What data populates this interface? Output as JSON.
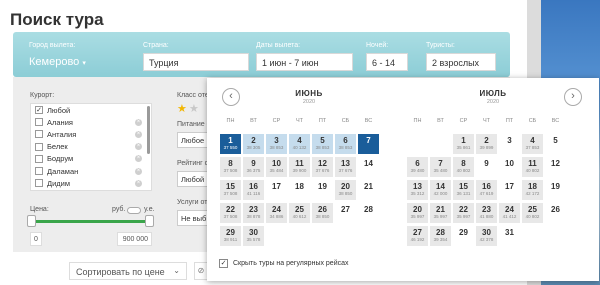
{
  "page": {
    "title": "Поиск тура"
  },
  "search": {
    "departure_label": "Город вылета:",
    "departure_value": "Кемерово",
    "country_label": "Страна:",
    "country_value": "Турция",
    "dates_label": "Даты вылета:",
    "dates_value": "1 июн - 7 июн",
    "nights_label": "Ночей:",
    "nights_value": "6 - 14",
    "tourists_label": "Туристы:",
    "tourists_value": "2 взрослых"
  },
  "filters": {
    "resort_label": "Курорт:",
    "resorts": [
      {
        "label": "Любой",
        "checked": true,
        "removable": false
      },
      {
        "label": "Алания",
        "checked": false,
        "removable": true
      },
      {
        "label": "Анталия",
        "checked": false,
        "removable": true
      },
      {
        "label": "Белек",
        "checked": false,
        "removable": true
      },
      {
        "label": "Бодрум",
        "checked": false,
        "removable": true
      },
      {
        "label": "Даламан",
        "checked": false,
        "removable": true
      },
      {
        "label": "Дидим",
        "checked": false,
        "removable": true
      }
    ],
    "hotel_class_label": "Класс оте",
    "meals_label": "Питание о",
    "meals_value": "Любое",
    "rating_label": "Рейтинг о",
    "rating_value": "Любой",
    "services_label": "Услуги от",
    "services_value": "Не выб",
    "price_label": "Цена:",
    "currency_rub": "руб.",
    "currency_ue": "у.е.",
    "price_min": "0",
    "price_max": "900 000"
  },
  "sort": {
    "label": "Сортировать по цене"
  },
  "calendar": {
    "weekdays": [
      "ПН",
      "ВТ",
      "СР",
      "ЧТ",
      "ПТ",
      "СБ",
      "ВС"
    ],
    "june": {
      "name": "ИЮНЬ",
      "year": "2020",
      "offset": 0,
      "days": [
        {
          "d": "1",
          "p": "37 550",
          "s": "sel"
        },
        {
          "d": "2",
          "p": "38 305",
          "s": "light"
        },
        {
          "d": "3",
          "p": "38 853",
          "s": "light"
        },
        {
          "d": "4",
          "p": "40 132",
          "s": "light"
        },
        {
          "d": "5",
          "p": "38 853",
          "s": "light"
        },
        {
          "d": "6",
          "p": "38 853",
          "s": "light"
        },
        {
          "d": "7",
          "p": "",
          "s": "sel"
        },
        {
          "d": "8",
          "p": "37 508",
          "s": "gray"
        },
        {
          "d": "9",
          "p": "36 375",
          "s": "gray"
        },
        {
          "d": "10",
          "p": "35 484",
          "s": "gray"
        },
        {
          "d": "11",
          "p": "39 900",
          "s": "gray"
        },
        {
          "d": "12",
          "p": "37 676",
          "s": "gray"
        },
        {
          "d": "13",
          "p": "37 676",
          "s": "gray"
        },
        {
          "d": "14",
          "p": "",
          "s": "none"
        },
        {
          "d": "15",
          "p": "37 508",
          "s": "gray"
        },
        {
          "d": "16",
          "p": "41 116",
          "s": "gray"
        },
        {
          "d": "17",
          "p": "",
          "s": "none"
        },
        {
          "d": "18",
          "p": "",
          "s": "none"
        },
        {
          "d": "19",
          "p": "",
          "s": "none"
        },
        {
          "d": "20",
          "p": "38 850",
          "s": "gray"
        },
        {
          "d": "21",
          "p": "",
          "s": "none"
        },
        {
          "d": "22",
          "p": "37 508",
          "s": "gray"
        },
        {
          "d": "23",
          "p": "38 878",
          "s": "gray"
        },
        {
          "d": "24",
          "p": "34 886",
          "s": "gray"
        },
        {
          "d": "25",
          "p": "40 612",
          "s": "gray"
        },
        {
          "d": "26",
          "p": "38 850",
          "s": "gray"
        },
        {
          "d": "27",
          "p": "",
          "s": "none"
        },
        {
          "d": "28",
          "p": "",
          "s": "none"
        },
        {
          "d": "29",
          "p": "38 911",
          "s": "gray"
        },
        {
          "d": "30",
          "p": "35 578",
          "s": "gray"
        }
      ]
    },
    "july": {
      "name": "ИЮЛЬ",
      "year": "2020",
      "offset": 2,
      "days": [
        {
          "d": "1",
          "p": "35 861",
          "s": "gray"
        },
        {
          "d": "2",
          "p": "39 899",
          "s": "gray"
        },
        {
          "d": "3",
          "p": "",
          "s": "none"
        },
        {
          "d": "4",
          "p": "37 853",
          "s": "gray"
        },
        {
          "d": "5",
          "p": "",
          "s": "none"
        },
        {
          "d": "6",
          "p": "39 480",
          "s": "gray"
        },
        {
          "d": "7",
          "p": "35 480",
          "s": "gray"
        },
        {
          "d": "8",
          "p": "40 802",
          "s": "gray"
        },
        {
          "d": "9",
          "p": "",
          "s": "none"
        },
        {
          "d": "10",
          "p": "",
          "s": "none"
        },
        {
          "d": "11",
          "p": "40 802",
          "s": "gray"
        },
        {
          "d": "12",
          "p": "",
          "s": "none"
        },
        {
          "d": "13",
          "p": "35 312",
          "s": "gray"
        },
        {
          "d": "14",
          "p": "42 000",
          "s": "gray"
        },
        {
          "d": "15",
          "p": "36 131",
          "s": "gray"
        },
        {
          "d": "16",
          "p": "47 619",
          "s": "gray"
        },
        {
          "d": "17",
          "p": "",
          "s": "none"
        },
        {
          "d": "18",
          "p": "42 172",
          "s": "gray"
        },
        {
          "d": "19",
          "p": "",
          "s": "none"
        },
        {
          "d": "20",
          "p": "35 997",
          "s": "gray"
        },
        {
          "d": "21",
          "p": "35 997",
          "s": "gray"
        },
        {
          "d": "22",
          "p": "35 997",
          "s": "gray"
        },
        {
          "d": "23",
          "p": "41 880",
          "s": "gray"
        },
        {
          "d": "24",
          "p": "41 412",
          "s": "gray"
        },
        {
          "d": "25",
          "p": "40 802",
          "s": "gray"
        },
        {
          "d": "26",
          "p": "",
          "s": "none"
        },
        {
          "d": "27",
          "p": "46 192",
          "s": "gray"
        },
        {
          "d": "28",
          "p": "39 354",
          "s": "gray"
        },
        {
          "d": "29",
          "p": "",
          "s": "none"
        },
        {
          "d": "30",
          "p": "42 378",
          "s": "gray"
        },
        {
          "d": "31",
          "p": "",
          "s": "none"
        }
      ]
    },
    "footer_label": "Скрыть туры на регулярных рейсах",
    "footer_checked": true
  }
}
